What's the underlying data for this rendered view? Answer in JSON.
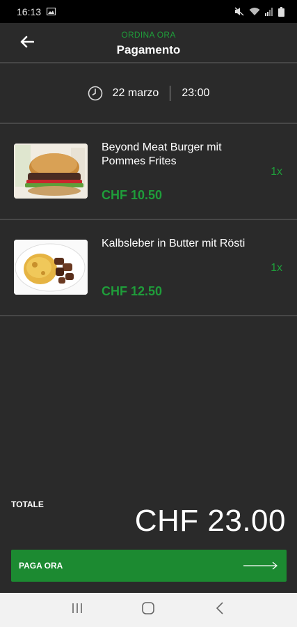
{
  "status_bar": {
    "time": "16:13"
  },
  "header": {
    "subtitle": "ORDINA ORA",
    "title": "Pagamento"
  },
  "schedule": {
    "date": "22 marzo",
    "time": "23:00"
  },
  "order_items": [
    {
      "name": "Beyond Meat Burger mit Pommes Frites",
      "price": "CHF 10.50",
      "quantity": "1x"
    },
    {
      "name": "Kalbsleber in Butter mit Rösti",
      "price": "CHF 12.50",
      "quantity": "1x"
    }
  ],
  "footer": {
    "total_label": "TOTALE",
    "total_amount": "CHF 23.00",
    "pay_button_label": "PAGA ORA"
  },
  "colors": {
    "accent": "#1f9d3a",
    "button": "#1c8a31",
    "background": "#2a2a2a",
    "status_bar": "#000000",
    "nav_bar": "#f2f2f2"
  }
}
